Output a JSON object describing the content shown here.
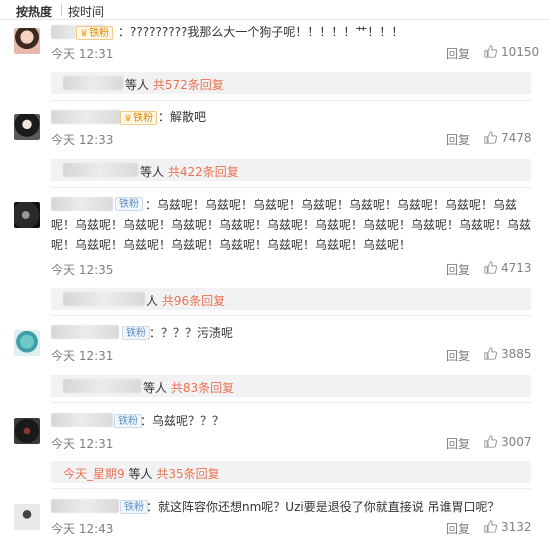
{
  "tabs": [
    {
      "label": "按热度"
    },
    {
      "label": "按时间"
    }
  ],
  "comments": [
    {
      "badge": "铁粉",
      "text": "：?????????我那么大一个狗子呢！！！！！艹！！！",
      "time": "今天 12:31",
      "reply_label": "回复",
      "likes": "10150",
      "sub": {
        "prefix": "等人",
        "more": "共572条回复"
      }
    },
    {
      "badge": "铁粉",
      "text": "：解散吧",
      "time": "今天 12:33",
      "reply_label": "回复",
      "likes": "7478",
      "sub": {
        "prefix": "等人",
        "more": "共422条回复"
      }
    },
    {
      "badge": "铁粉",
      "text": "：乌兹呢！乌兹呢！乌兹呢！乌兹呢！乌兹呢！乌兹呢！乌兹呢！乌兹呢！乌兹呢！乌兹呢！乌兹呢！乌兹呢！乌兹呢！乌兹呢！乌兹呢！乌兹呢！乌兹呢！乌兹呢！乌兹呢！乌兹呢！乌兹呢！乌兹呢！乌兹呢！乌兹呢！乌兹呢！",
      "time": "今天 12:35",
      "reply_label": "回复",
      "likes": "4713",
      "sub": {
        "prefix": "人",
        "more": "共96条回复"
      }
    },
    {
      "badge": "铁粉",
      "text": "：？？？污渍呢",
      "time": "今天 12:31",
      "reply_label": "回复",
      "likes": "3885",
      "sub": {
        "prefix": "等人",
        "more": "共83条回复"
      }
    },
    {
      "badge": "铁粉",
      "text": "：乌兹呢？？？",
      "time": "今天 12:31",
      "reply_label": "回复",
      "likes": "3007",
      "sub": {
        "link": "今天_星期9",
        "prefix": "等人",
        "more": "共35条回复"
      }
    },
    {
      "badge": "铁粉",
      "text": "：就这阵容你还想nm呢？Uzi要是退役了你就直接说 吊谁胃口呢？",
      "time": "今天 12:43",
      "reply_label": "回复",
      "likes": "3132"
    }
  ],
  "colors": {
    "accent": "#eb7350",
    "badge_blue": "#5b8fc7",
    "badge_gold": "#e28a00",
    "meta": "#808080"
  },
  "icons": {
    "like": "thumbs-up-icon",
    "badge_crown": "crown-icon"
  }
}
